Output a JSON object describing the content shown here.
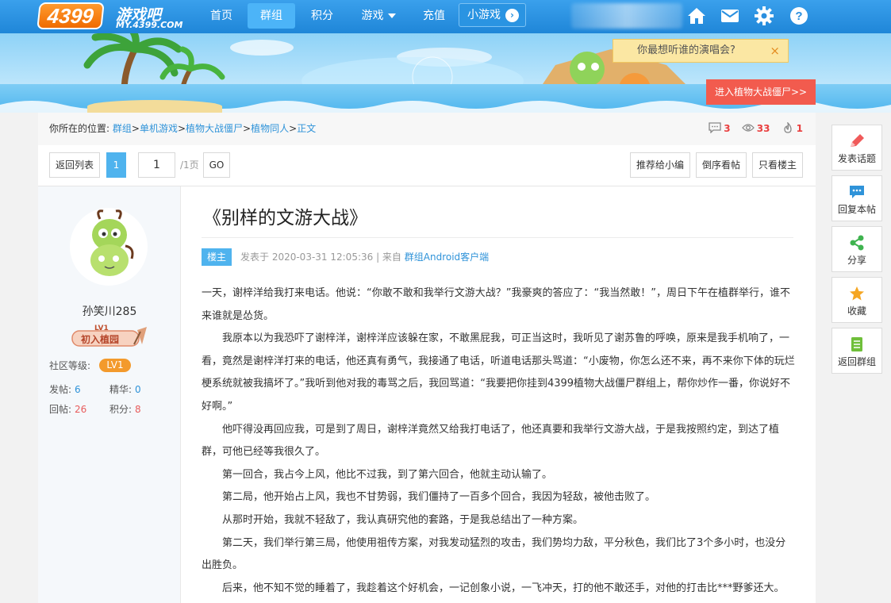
{
  "nav": {
    "logo_num": "4399",
    "logo_cn": "游戏吧",
    "logo_url": "MY.4399.COM",
    "items": [
      {
        "label": "首页"
      },
      {
        "label": "群组"
      },
      {
        "label": "积分"
      },
      {
        "label": "游戏"
      },
      {
        "label": "充值"
      }
    ],
    "mini_games": "小游戏",
    "icons": [
      "home-icon",
      "mail-icon",
      "gear-icon",
      "help-icon"
    ]
  },
  "banner": {
    "bubble_text": "你最想听谁的演唱会?",
    "bubble_close": "×",
    "enter_button": "进入植物大战僵尸>>"
  },
  "breadcrumb": {
    "prefix": "你所在的位置:",
    "items": [
      "群组",
      "单机游戏",
      "植物大战僵尸",
      "植物同人",
      "正文"
    ],
    "sep": ">"
  },
  "stats": {
    "comments": "3",
    "views": "33",
    "likes": "1"
  },
  "pager": {
    "back": "返回列表",
    "current": "1",
    "input_value": "1",
    "total": "/1页",
    "go": "GO",
    "recommend": "推荐给小编",
    "reverse": "倒序看帖",
    "only_op": "只看楼主"
  },
  "user": {
    "name": "孙笑川285",
    "medal_level": "LV1",
    "medal_title": "初入植园",
    "level_label": "社区等级:",
    "level": "LV1",
    "stats": [
      {
        "label": "发帖:",
        "value": "6"
      },
      {
        "label": "精华:",
        "value": "0"
      },
      {
        "label": "回帖:",
        "value": "26"
      },
      {
        "label": "积分:",
        "value": "8"
      }
    ]
  },
  "post": {
    "title": "《别样的文游大战》",
    "badge": "楼主",
    "meta_prefix": "发表于 2020-03-31 12:05:36 | 来自",
    "meta_source": "群组Android客户端",
    "paragraphs": [
      "一天，谢梓洋给我打来电话。他说：“你敢不敢和我举行文游大战？”我豪爽的答应了：“我当然敢！”，周日下午在植群举行，谁不来谁就是怂货。",
      "我原本以为我恐吓了谢梓洋，谢梓洋应该躲在家，不敢黑屁我，可正当这时，我听见了谢苏鲁的呼唤，原来是我手机响了，一看，竟然是谢梓洋打来的电话，他还真有勇气，我接通了电话，听道电话那头骂道：“小废物，你怎么还不来，再不来你下体的玩烂梗系统就被我搞坏了。”我听到他对我的毒骂之后，我回骂道：“我要把你挂到4399植物大战僵尸群组上，帮你炒作一番，你说好不好啊。”",
      "他吓得没再回应我，可是到了周日，谢梓洋竟然又给我打电话了，他还真要和我举行文游大战，于是我按照约定，到达了植群，可他已经等我很久了。",
      "第一回合，我占今上风，他比不过我，到了第六回合，他就主动认输了。",
      "第二局，他开始占上风，我也不甘势弱，我们僵持了一百多个回合，我因为轻敌，被他击败了。",
      "从那时开始，我就不轻敌了，我认真研究他的套路，于是我总结出了一种方案。",
      "第二天，我们举行第三局，他使用祖传方案，对我发动猛烈的攻击，我们势均力敌，平分秋色，我们比了3个多小时，也没分出胜负。",
      "后来，他不知不觉的睡着了，我趁着这个好机会，一记创象小说，一飞冲天，打的他不敢还手，对他的打击比***野爹还大。"
    ]
  },
  "tools": [
    {
      "label": "发表话题",
      "icon": "pencil-icon"
    },
    {
      "label": "回复本帖",
      "icon": "chat-icon"
    },
    {
      "label": "分享",
      "icon": "share-icon"
    },
    {
      "label": "收藏",
      "icon": "star-icon"
    },
    {
      "label": "返回群组",
      "icon": "list-icon"
    }
  ],
  "colors": {
    "nav": "#1f86d8",
    "accent": "#4fb3ee",
    "link": "#2f93d9",
    "alert": "#e94040",
    "orange": "#f39a2c"
  }
}
